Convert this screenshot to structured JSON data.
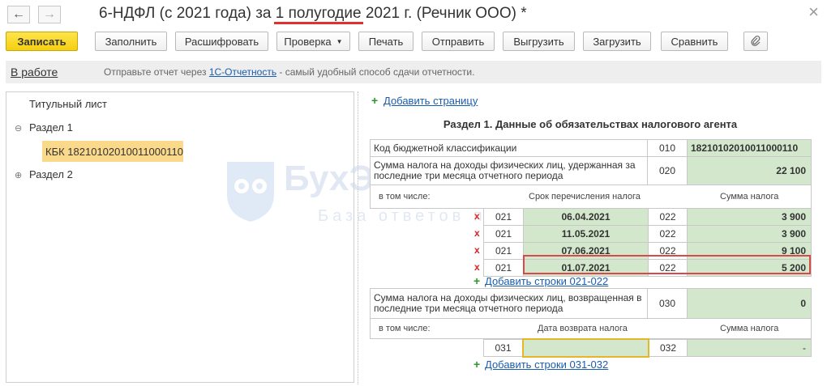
{
  "window": {
    "title_prefix": "6-НДФЛ (с 2021 года) за ",
    "title_period": "1 полугодие",
    "title_suffix": " 2021 г. (Речник ООО) *"
  },
  "toolbar": {
    "save": "Записать",
    "fill": "Заполнить",
    "decode": "Расшифровать",
    "check": "Проверка",
    "print": "Печать",
    "send": "Отправить",
    "export": "Выгрузить",
    "import": "Загрузить",
    "compare": "Сравнить"
  },
  "status": {
    "state_link": "В работе",
    "msg_before": "Отправьте отчет через ",
    "msg_link": "1С-Отчетность",
    "msg_after": " - самый удобный способ сдачи отчетности."
  },
  "tree": {
    "title_sheet": "Титульный лист",
    "section1": "Раздел 1",
    "kbk": "КБК 18210102010011000110",
    "section2": "Раздел 2"
  },
  "form": {
    "add_page": "Добавить страницу",
    "section_title": "Раздел 1. Данные об обязательствах налогового агента",
    "kbk_label": "Код бюджетной классификации",
    "kbk_code": "010",
    "kbk_value": "18210102010011000110",
    "withheld_label": "Сумма налога на доходы физических лиц, удержанная за последние три месяца отчетного периода",
    "withheld_code": "020",
    "withheld_value": "22 100",
    "including": "в том числе:",
    "col_due_date": "Срок перечисления налога",
    "col_tax_sum": "Сумма налога",
    "rows": [
      {
        "del": "x",
        "code1": "021",
        "date": "06.04.2021",
        "code2": "022",
        "sum": "3 900"
      },
      {
        "del": "x",
        "code1": "021",
        "date": "11.05.2021",
        "code2": "022",
        "sum": "3 900"
      },
      {
        "del": "x",
        "code1": "021",
        "date": "07.06.2021",
        "code2": "022",
        "sum": "9 100"
      },
      {
        "del": "x",
        "code1": "021",
        "date": "01.07.2021",
        "code2": "022",
        "sum": "5 200"
      }
    ],
    "add_rows_021": "Добавить строки 021-022",
    "returned_label": "Сумма налога на доходы физических лиц, возвращенная в последние три месяца отчетного периода",
    "returned_code": "030",
    "returned_value": "0",
    "including2": "в том числе:",
    "col_return_date": "Дата возврата налога",
    "col_tax_sum2": "Сумма налога",
    "ret_code1": "031",
    "ret_date": "",
    "ret_code2": "032",
    "ret_sum": "-",
    "add_rows_031": "Добавить строки 031-032"
  },
  "watermark": {
    "line1": "БухЭксперт8",
    "line2": "База ответов по учету"
  },
  "colors": {
    "accent_yellow": "#f5cf10",
    "selection": "#fbd98a",
    "cell_green": "#d3e7cd",
    "highlight_red": "#d84a4a",
    "highlight_gold": "#e6b62a",
    "link_blue": "#1a5dad"
  }
}
